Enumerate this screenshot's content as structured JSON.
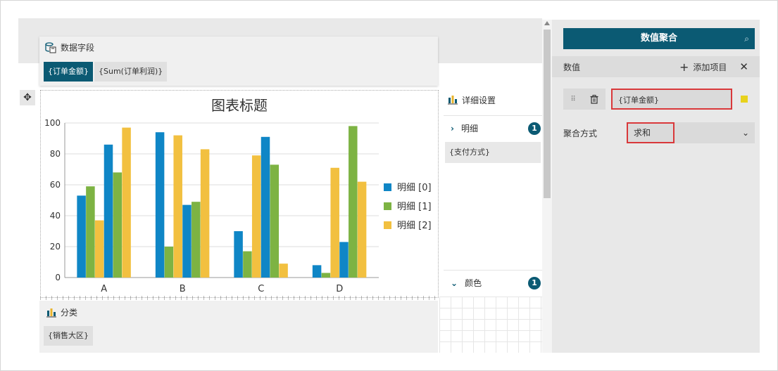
{
  "data_fields": {
    "header": "数据字段",
    "chips": [
      "{订单金额}",
      "{Sum(订单利润)}"
    ]
  },
  "category": {
    "header": "分类",
    "chip": "{销售大区}"
  },
  "detail_settings": {
    "header": "详细设置",
    "detail_section": {
      "label": "明细",
      "count": "1"
    },
    "detail_chip": "{支付方式}",
    "color_section": {
      "label": "颜色",
      "count": "1"
    }
  },
  "right_panel": {
    "title": "数值聚合",
    "values_label": "数值",
    "add_item_label": "添加项目",
    "value_item": "{订单金额}",
    "aggregation_label": "聚合方式",
    "aggregation_value": "求和",
    "accent_color": "#0b5a73",
    "item_color": "#e8d21d"
  },
  "chart_data": {
    "type": "bar",
    "title": "图表标题",
    "categories": [
      "A",
      "B",
      "C",
      "D"
    ],
    "ylim": [
      0,
      100
    ],
    "yticks": [
      0,
      20,
      40,
      60,
      80,
      100
    ],
    "grid": true,
    "legend_position": "right",
    "series": [
      {
        "name": "明细 [0]",
        "color": "#0f86c6",
        "values": [
          53,
          94,
          30,
          8
        ]
      },
      {
        "name": "明细 [1]",
        "color": "#7db343",
        "values": [
          59,
          20,
          17,
          3
        ]
      },
      {
        "name": "明细 [2]",
        "color": "#f2c040",
        "values": [
          37,
          92,
          79,
          71
        ]
      },
      {
        "name": "明细 [0]",
        "color": "#0f86c6",
        "values": [
          86,
          47,
          91,
          23
        ]
      },
      {
        "name": "明细 [1]",
        "color": "#7db343",
        "values": [
          68,
          49,
          73,
          98
        ]
      },
      {
        "name": "明细 [2]",
        "color": "#f2c040",
        "values": [
          97,
          83,
          9,
          62
        ]
      }
    ],
    "legend": [
      {
        "name": "明细 [0]",
        "color": "#0f86c6"
      },
      {
        "name": "明细 [1]",
        "color": "#7db343"
      },
      {
        "name": "明细 [2]",
        "color": "#f2c040"
      }
    ]
  }
}
